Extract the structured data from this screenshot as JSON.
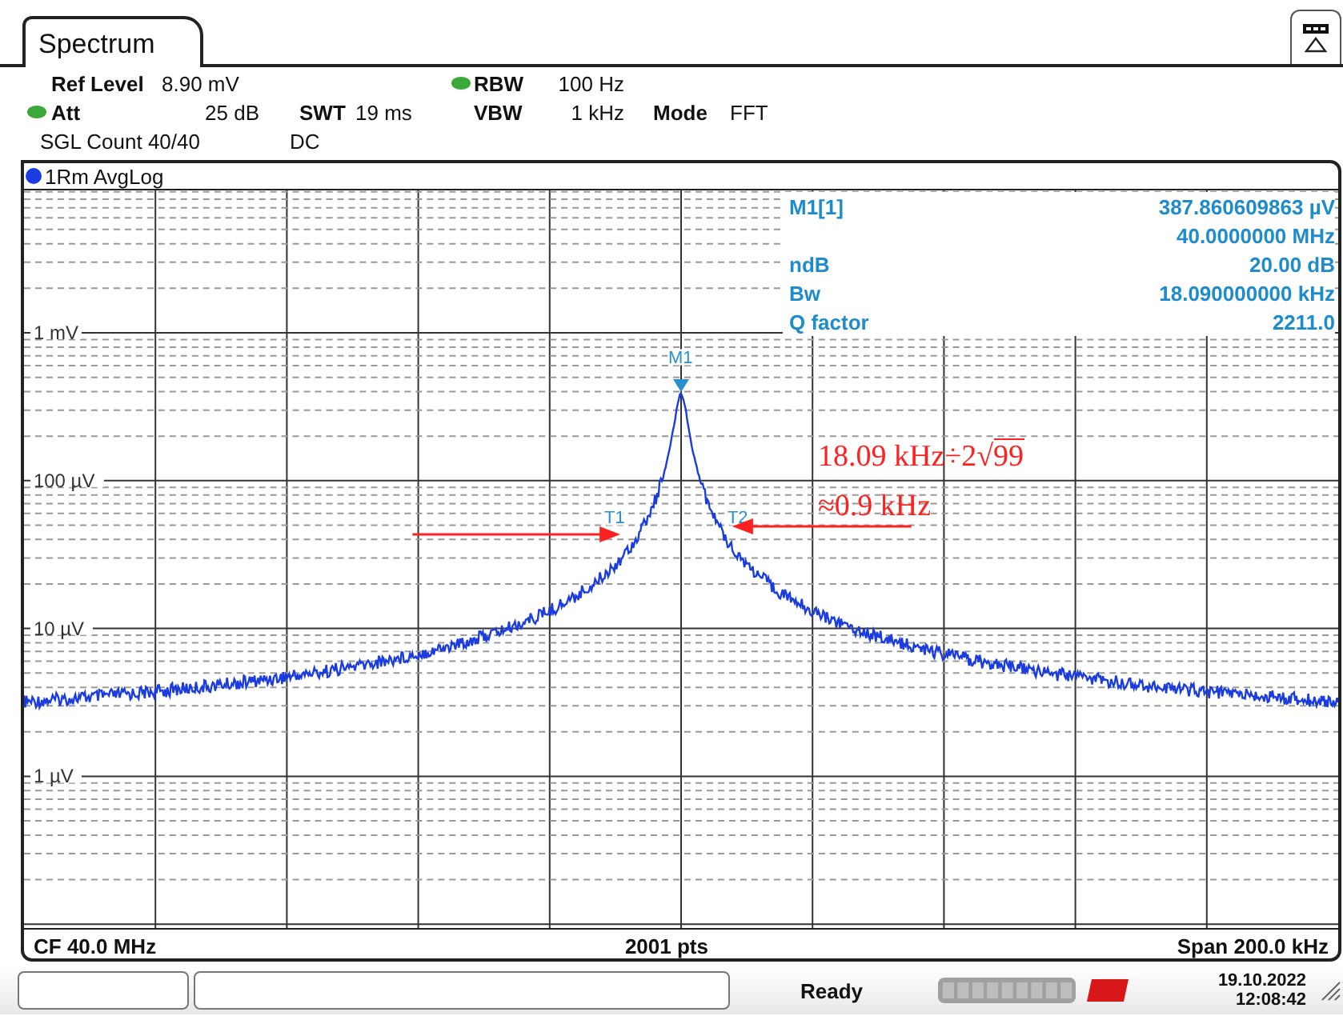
{
  "tab": {
    "label": "Spectrum",
    "selected": true
  },
  "settings": {
    "ref_level": {
      "label": "Ref Level",
      "value": "8.90 mV"
    },
    "att": {
      "label": "Att",
      "value": "25 dB",
      "indicator": true
    },
    "swt": {
      "label": "SWT",
      "value": "19 ms"
    },
    "rbw": {
      "label": "RBW",
      "value": "100 Hz",
      "indicator": true
    },
    "vbw": {
      "label": "VBW",
      "value": "1 kHz"
    },
    "mode": {
      "label": "Mode",
      "value": "FFT"
    },
    "sgl_count": "SGL Count 40/40",
    "coupling": "DC"
  },
  "trace": {
    "label": "1Rm AvgLog",
    "color": "#1a3ce0"
  },
  "marker_table": [
    {
      "label": "M1[1]",
      "value": "387.860609863 µV"
    },
    {
      "value": "40.0000000 MHz"
    },
    {
      "label": "ndB",
      "value": "20.00 dB"
    },
    {
      "label": "Bw",
      "value": "18.090000000 kHz"
    },
    {
      "label": "Q factor",
      "value": "2211.0"
    }
  ],
  "y_labels": [
    "1 mV",
    "100 µV",
    "10 µV",
    "1 µV"
  ],
  "markers": [
    {
      "label": "M1"
    },
    {
      "label": "T1"
    },
    {
      "label": "T2"
    }
  ],
  "annotation": {
    "line1": "18.09 kHz÷2√",
    "radicand": "99",
    "line2": "≈0.9 kHz"
  },
  "footer": {
    "center": "CF 40.0 MHz",
    "points": "2001 pts",
    "span": "Span 200.0 kHz"
  },
  "status": {
    "state": "Ready",
    "date": "19.10.2022",
    "time": "12:08:42"
  }
}
